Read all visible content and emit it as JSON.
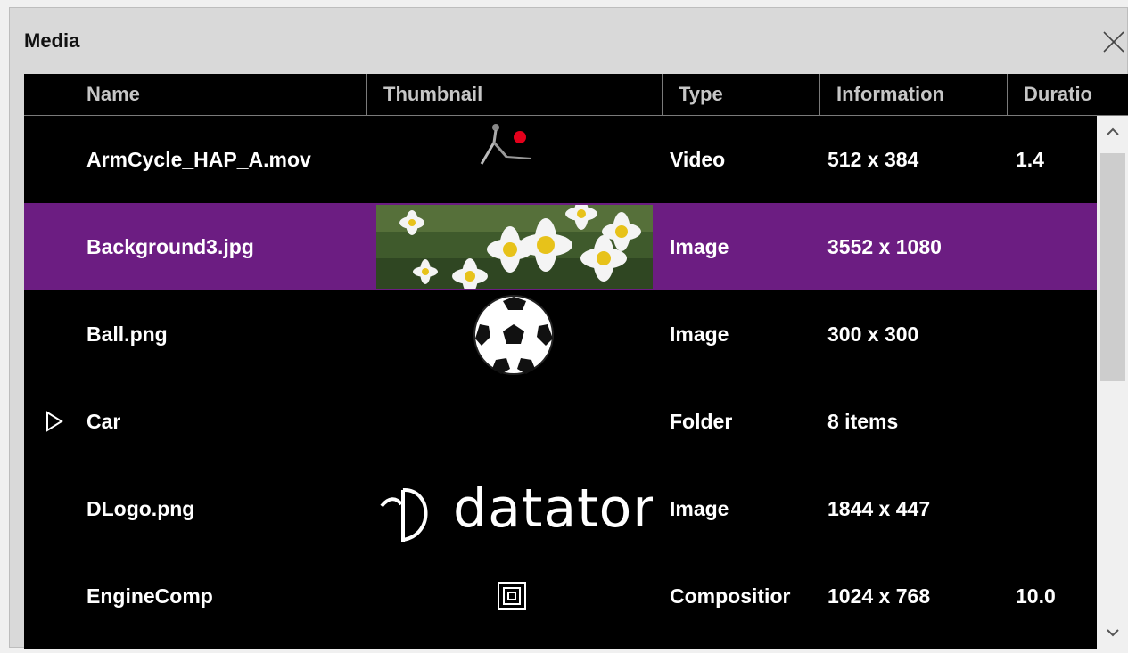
{
  "window": {
    "title": "Media",
    "close_icon": "close-icon"
  },
  "columns": [
    "Name",
    "Thumbnail",
    "Type",
    "Information",
    "Duratio"
  ],
  "rows": [
    {
      "name": "ArmCycle_HAP_A.mov",
      "thumbnail": "arm-video-thumbnail",
      "type": "Video",
      "info": "512 x 384",
      "duration": "1.4",
      "selected": false
    },
    {
      "name": "Background3.jpg",
      "thumbnail": "daisy-flowers-thumbnail",
      "type": "Image",
      "info": "3552 x 1080",
      "duration": "",
      "selected": true
    },
    {
      "name": "Ball.png",
      "thumbnail": "soccer-ball-thumbnail",
      "type": "Image",
      "info": "300 x 300",
      "duration": "",
      "selected": false
    },
    {
      "name": "Car",
      "thumbnail": "",
      "type": "Folder",
      "info": "8 items",
      "duration": "",
      "selected": false,
      "expandable": true
    },
    {
      "name": "DLogo.png",
      "thumbnail": "dataton-logo-thumbnail",
      "type": "Image",
      "info": "1844 x 447",
      "duration": "",
      "selected": false
    },
    {
      "name": "EngineComp",
      "thumbnail": "composition-icon",
      "type": "Compositior",
      "info": "1024 x 768",
      "duration": "10.0",
      "selected": false
    }
  ],
  "logo_text": "dataton",
  "colors": {
    "selection": "#6c1d82",
    "grid_bg": "#000000",
    "header_text": "#c6c6c6",
    "row_text": "#ffffff"
  },
  "scrollbar": {
    "up_icon": "chevron-up-icon",
    "down_icon": "chevron-down-icon"
  }
}
